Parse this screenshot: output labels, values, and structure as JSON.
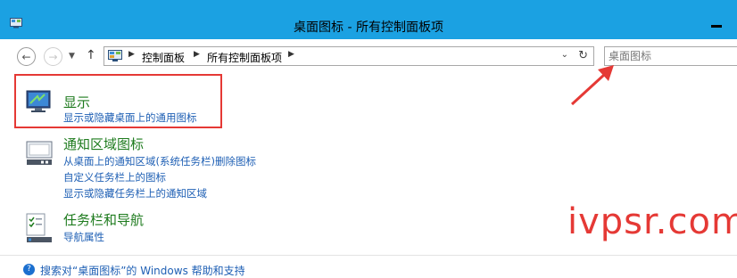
{
  "window": {
    "title": "桌面图标 - 所有控制面板项"
  },
  "address_bar": {
    "breadcrumbs": [
      "控制面板",
      "所有控制面板项"
    ]
  },
  "search": {
    "placeholder": "桌面图标"
  },
  "items": [
    {
      "heading": "显示",
      "links": [
        "显示或隐藏桌面上的通用图标"
      ]
    },
    {
      "heading": "通知区域图标",
      "links": [
        "从桌面上的通知区域(系统任务栏)删除图标",
        "自定义任务栏上的图标",
        "显示或隐藏任务栏上的通知区域"
      ]
    },
    {
      "heading": "任务栏和导航",
      "links": [
        "导航属性"
      ]
    }
  ],
  "help": {
    "text": "搜索对“桌面图标”的 Windows 帮助和支持"
  },
  "watermark": {
    "text": "ivpsr.com"
  },
  "colors": {
    "titlebar": "#1ba1e2",
    "heading_green": "#1e7b1e",
    "link_blue": "#1e5fb4",
    "annotation_red": "#e53935"
  }
}
